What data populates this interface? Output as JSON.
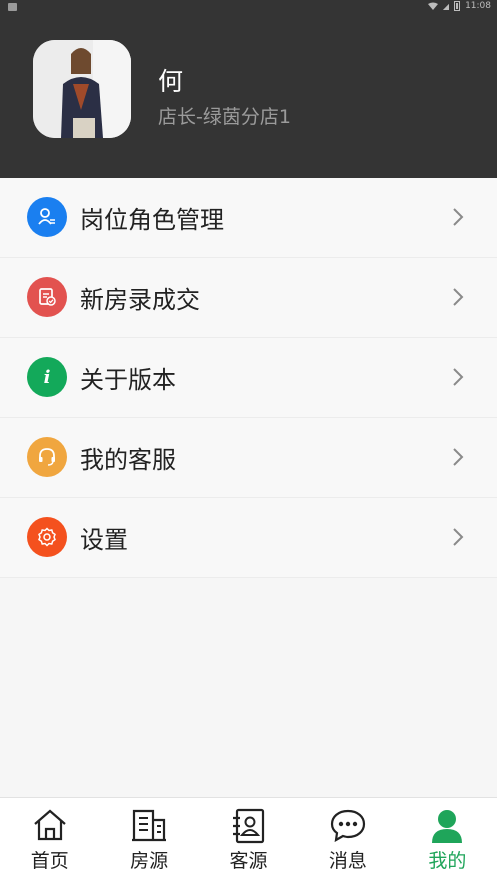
{
  "status_bar": {
    "time": "11:08"
  },
  "profile": {
    "name": "何",
    "role": "店长-绿茵分店1"
  },
  "menu": {
    "items": [
      {
        "label": "岗位角色管理",
        "icon": "person-role-icon",
        "color": "#1a7ff0"
      },
      {
        "label": "新房录成交",
        "icon": "document-check-icon",
        "color": "#e2524f"
      },
      {
        "label": "关于版本",
        "icon": "info-icon",
        "color": "#13a95a"
      },
      {
        "label": "我的客服",
        "icon": "headset-icon",
        "color": "#f0a63f"
      },
      {
        "label": "设置",
        "icon": "gear-icon",
        "color": "#f4511e"
      }
    ]
  },
  "tabbar": {
    "active_color": "#1fa55a",
    "items": [
      {
        "label": "首页",
        "icon": "home-icon"
      },
      {
        "label": "房源",
        "icon": "building-icon"
      },
      {
        "label": "客源",
        "icon": "contact-book-icon"
      },
      {
        "label": "消息",
        "icon": "chat-bubble-icon"
      },
      {
        "label": "我的",
        "icon": "person-icon",
        "active": true
      }
    ]
  }
}
